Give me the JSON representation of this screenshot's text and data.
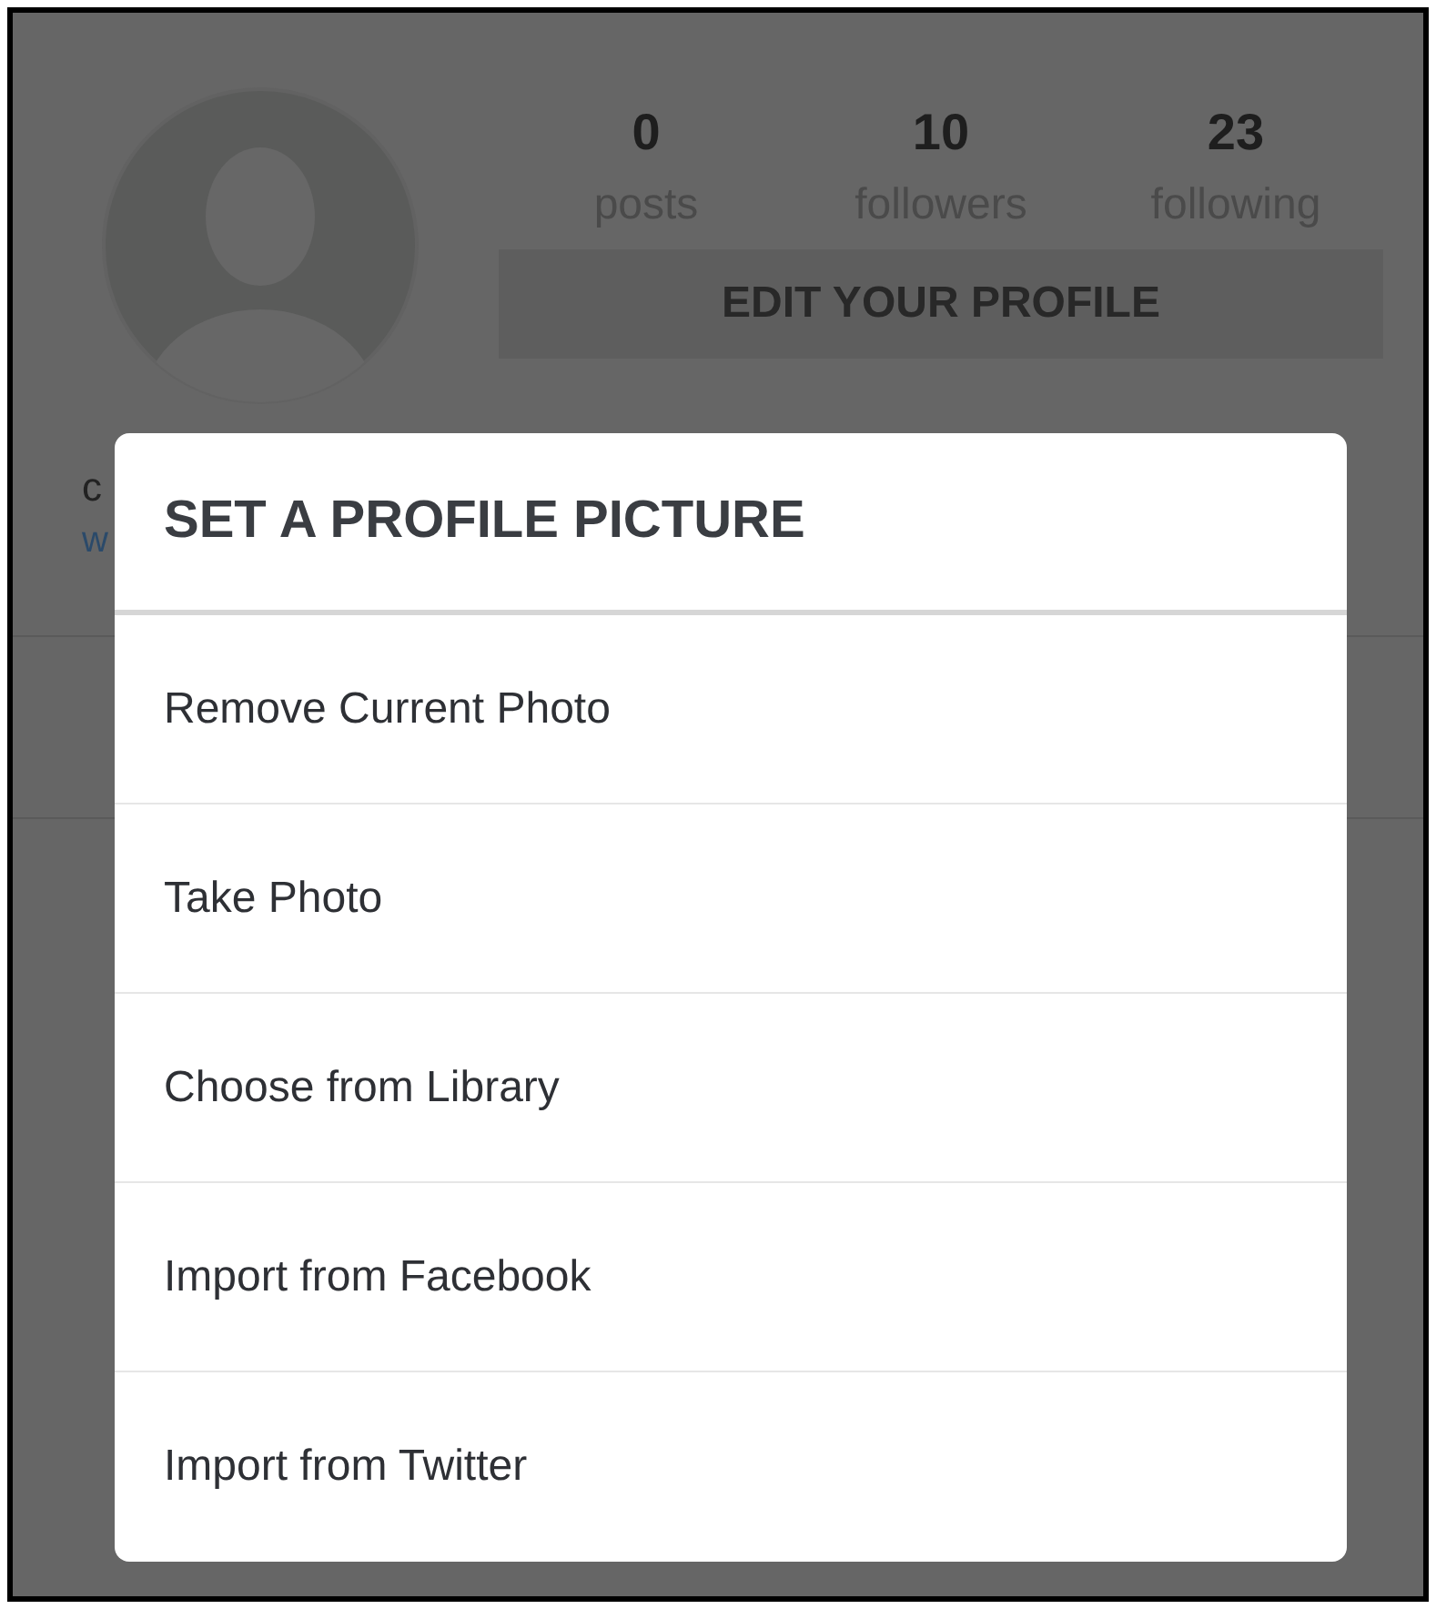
{
  "profile": {
    "stats": [
      {
        "value": "0",
        "label": "posts"
      },
      {
        "value": "10",
        "label": "followers"
      },
      {
        "value": "23",
        "label": "following"
      }
    ],
    "edit_button": "EDIT YOUR PROFILE",
    "name_line": "c",
    "link_line": "w"
  },
  "dialog": {
    "title": "SET A PROFILE PICTURE",
    "options": [
      "Remove Current Photo",
      "Take Photo",
      "Choose from Library",
      "Import from Facebook",
      "Import from Twitter"
    ]
  }
}
